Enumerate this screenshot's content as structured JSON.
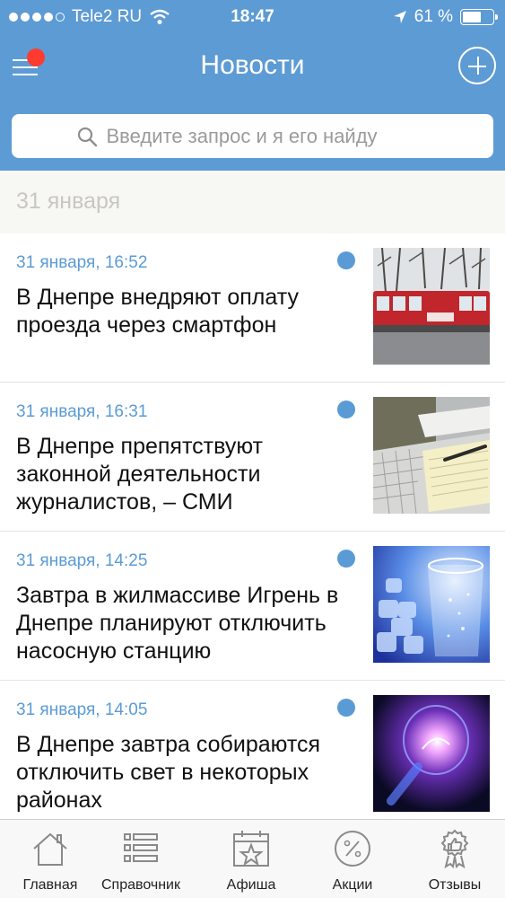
{
  "status_bar": {
    "carrier": "Tele2 RU",
    "time": "18:47",
    "battery": "61 %",
    "battery_level": 0.61
  },
  "nav": {
    "title": "Новости"
  },
  "search": {
    "placeholder": "Введите запрос и я его найду"
  },
  "section": {
    "date": "31 января"
  },
  "news": [
    {
      "time": "31 января, 16:52",
      "title": "В Днепре внедряют оплату проезда через смартфон",
      "image": "tram"
    },
    {
      "time": "31 января, 16:31",
      "title": "В Днепре препятствуют законной деятельности журналистов, – СМИ",
      "image": "laptop-notebook"
    },
    {
      "time": "31 января, 14:25",
      "title": "Завтра в жилмассиве Игрень в Днепре планируют отключить насосную станцию",
      "image": "water-glass"
    },
    {
      "time": "31 января, 14:05",
      "title": "В Днепре завтра собираются отключить свет в некоторых районах",
      "image": "light-bulb"
    }
  ],
  "tabs": [
    {
      "label": "Главная",
      "icon": "home-icon"
    },
    {
      "label": "Справочник",
      "icon": "list-icon"
    },
    {
      "label": "Афиша",
      "icon": "calendar-star-icon"
    },
    {
      "label": "Акции",
      "icon": "percent-icon"
    },
    {
      "label": "Отзывы",
      "icon": "thumbs-up-icon"
    }
  ],
  "colors": {
    "header": "#5d9bd4",
    "accent": "#5b9bd5",
    "badge": "#ff3b30"
  }
}
